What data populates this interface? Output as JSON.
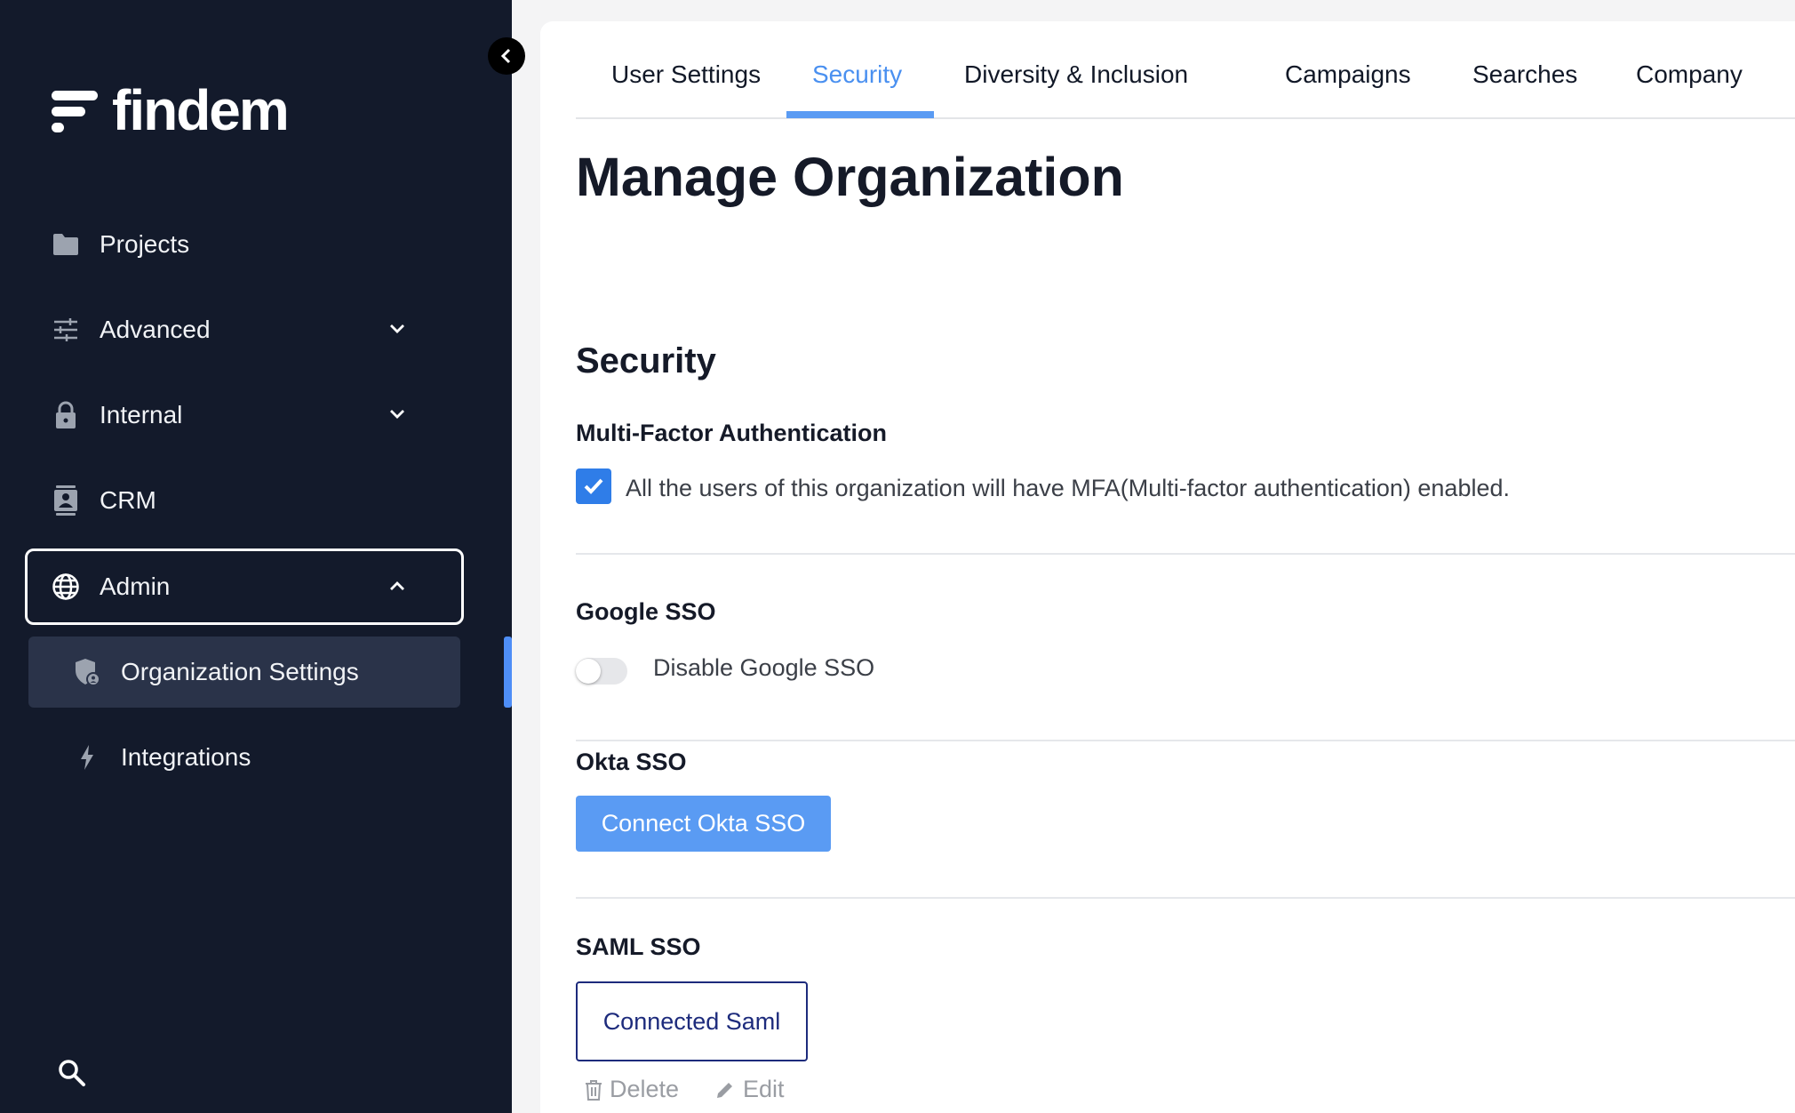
{
  "brand": {
    "name": "findem"
  },
  "sidebar": {
    "items": [
      {
        "label": "Projects",
        "icon": "folder-icon"
      },
      {
        "label": "Advanced",
        "icon": "sliders-icon",
        "expandable": true
      },
      {
        "label": "Internal",
        "icon": "lock-icon",
        "expandable": true
      },
      {
        "label": "CRM",
        "icon": "contact-card-icon"
      },
      {
        "label": "Admin",
        "icon": "globe-icon",
        "expanded": true
      }
    ],
    "subitems": [
      {
        "label": "Organization Settings",
        "icon": "shield-icon",
        "active": true
      },
      {
        "label": "Integrations",
        "icon": "bolt-icon"
      }
    ],
    "search_icon": "search-icon"
  },
  "tabs": [
    {
      "label": "User Settings"
    },
    {
      "label": "Security",
      "active": true
    },
    {
      "label": "Diversity & Inclusion"
    },
    {
      "label": "Campaigns"
    },
    {
      "label": "Searches"
    },
    {
      "label": "Company"
    }
  ],
  "page": {
    "title": "Manage Organization"
  },
  "security": {
    "title": "Security",
    "mfa": {
      "label": "Multi-Factor Authentication",
      "text": "All the users of this organization will have MFA(Multi-factor authentication) enabled.",
      "checked": true
    },
    "google": {
      "label": "Google SSO",
      "toggle_text": "Disable Google SSO",
      "enabled": false
    },
    "okta": {
      "label": "Okta SSO",
      "button": "Connect Okta SSO"
    },
    "saml": {
      "label": "SAML SSO",
      "status": "Connected Saml",
      "delete": "Delete",
      "edit": "Edit"
    }
  },
  "colors": {
    "sidebar_bg": "#131a2b",
    "accent": "#5a9bf3",
    "checkbox": "#2f7de8",
    "saml_border": "#1d2b7c"
  }
}
